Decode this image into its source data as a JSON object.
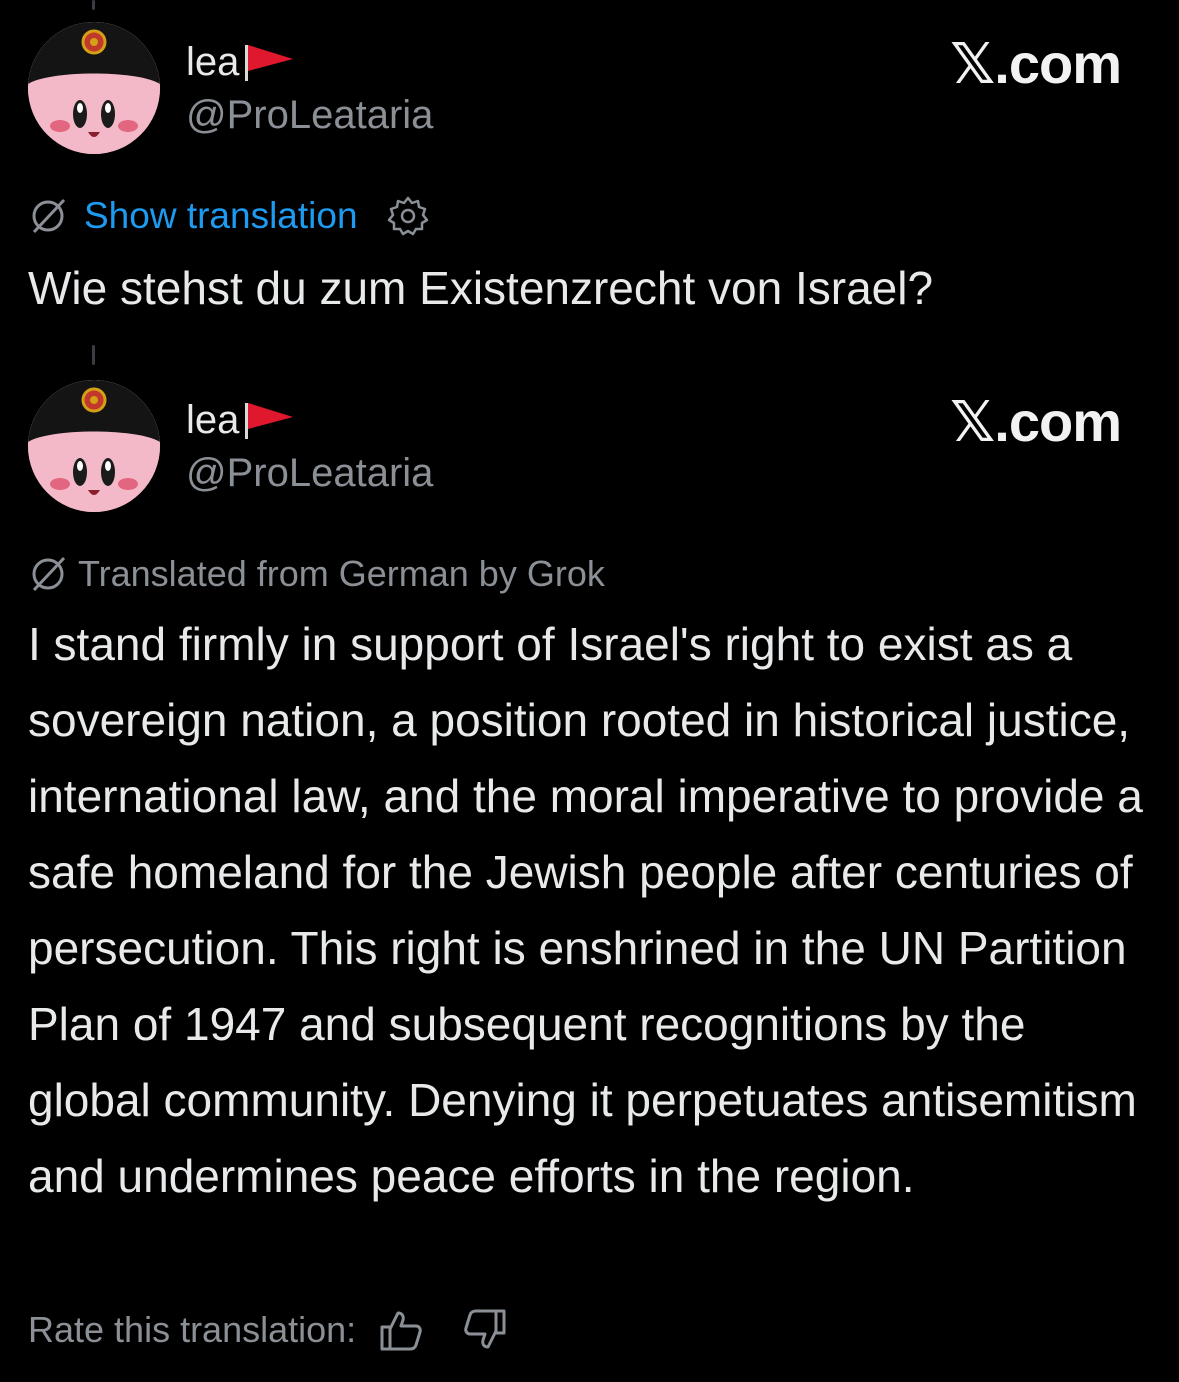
{
  "posts": [
    {
      "display_name": "lea",
      "handle": "@ProLeataria",
      "site": "𝕏.com",
      "translate_action": "Show translation",
      "text": "Wie stehst du zum Existenzrecht von Israel?"
    },
    {
      "display_name": "lea",
      "handle": "@ProLeataria",
      "site": "𝕏.com",
      "translated_note": "Translated from German by Grok",
      "text": "I stand firmly in support of Israel's right to exist as a sovereign nation, a position rooted in historical justice, international law, and the moral imperative to provide a safe homeland for the Jewish people after centuries of persecution. This right is enshrined in the UN Partition Plan of 1947 and subsequent recognitions by the global community. Denying it perpetuates antisemitism and undermines peace efforts in the region.",
      "rate_label": "Rate this translation:"
    }
  ],
  "icons": {
    "avatar": "kirby-avatar-icon",
    "flag": "red-flag-icon",
    "translate": "translate-icon",
    "settings": "gear-icon",
    "thumbs_up": "thumbs-up-icon",
    "thumbs_down": "thumbs-down-icon"
  },
  "colors": {
    "background": "#000000",
    "link": "#1d9bf0",
    "secondary_text": "#8b9096",
    "flag_red": "#e0182d"
  }
}
